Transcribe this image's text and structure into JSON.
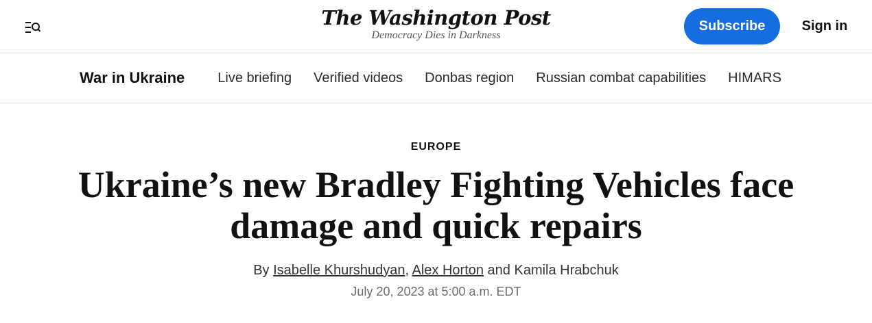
{
  "header": {
    "logo_text": "The Washington Post",
    "tagline": "Democracy Dies in Darkness",
    "menu_icon": "menu-search-icon",
    "subscribe_label": "Subscribe",
    "signin_label": "Sign in",
    "accent_color": "#166de0"
  },
  "section_nav": {
    "title": "War in Ukraine",
    "links": [
      "Live briefing",
      "Verified videos",
      "Donbas region",
      "Russian combat capabilities",
      "HIMARS"
    ]
  },
  "article": {
    "kicker": "EUROPE",
    "headline": "Ukraine’s new Bradley Fighting Vehicles face damage and quick repairs",
    "byline": {
      "prefix": "By ",
      "author1": "Isabelle Khurshudyan",
      "sep1": ", ",
      "author2": "Alex Horton",
      "sep2": " and ",
      "author3": "Kamila Hrabchuk"
    },
    "timestamp": "July 20, 2023 at 5:00 a.m. EDT"
  }
}
